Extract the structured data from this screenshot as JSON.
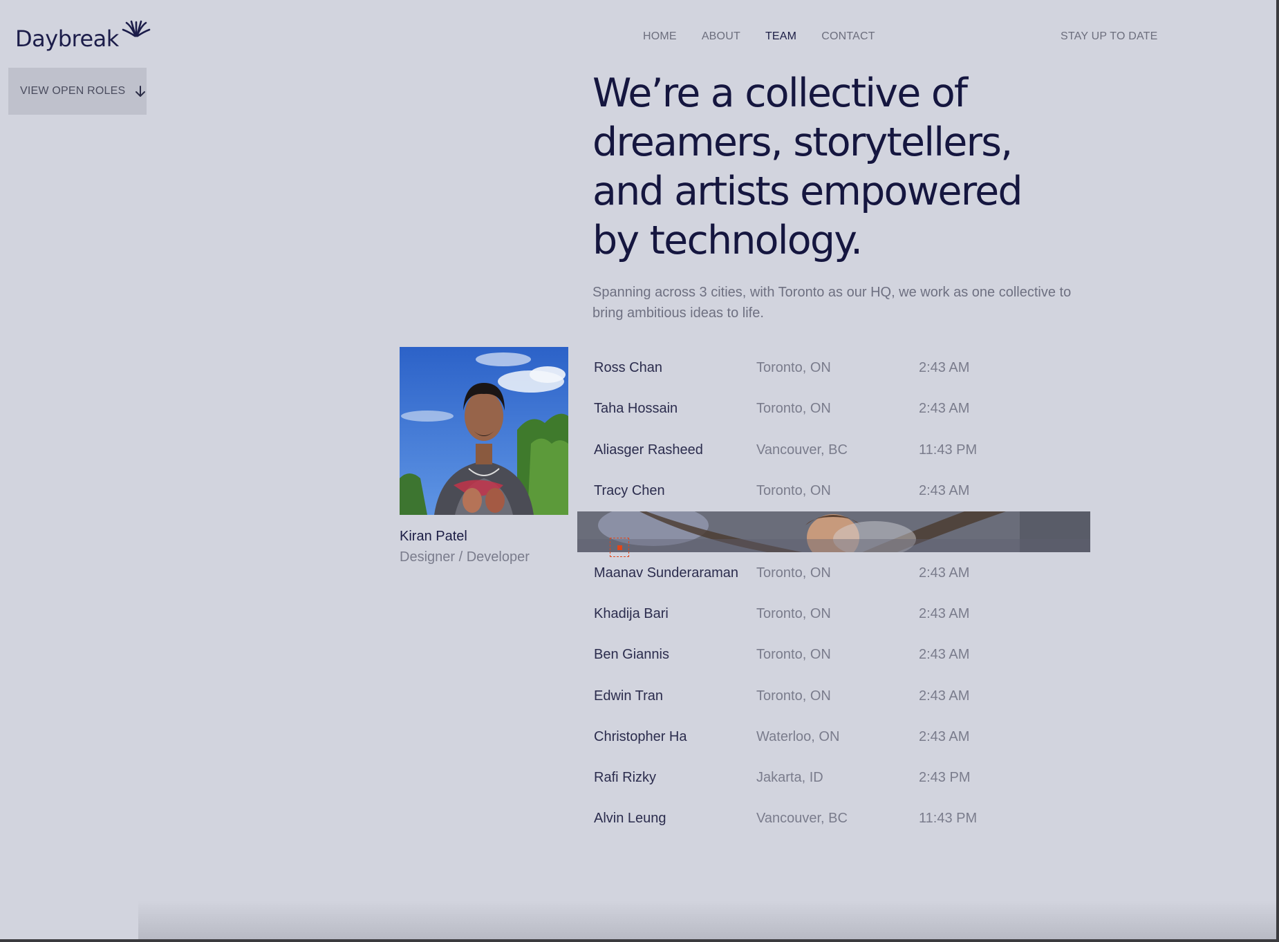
{
  "brand": {
    "name": "Daybreak"
  },
  "nav": {
    "items": [
      {
        "label": "HOME",
        "active": false
      },
      {
        "label": "ABOUT",
        "active": false
      },
      {
        "label": "TEAM",
        "active": true
      },
      {
        "label": "CONTACT",
        "active": false
      }
    ],
    "cta": "STAY UP TO DATE"
  },
  "roles_button": {
    "label": "VIEW OPEN ROLES",
    "icon": "arrow-down-icon"
  },
  "hero": {
    "headline_lines": [
      "We’re a collective of",
      "dreamers, storytellers,",
      "and artists empowered",
      "by technology."
    ],
    "subtitle": "Spanning across 3 cities, with Toronto as our HQ, we work as one collective to bring ambitious ideas to life."
  },
  "feature": {
    "name": "Kiran Patel",
    "role": "Designer / Developer"
  },
  "team": [
    {
      "name": "Ross Chan",
      "city": "Toronto, ON",
      "time": "2:43 AM"
    },
    {
      "name": "Taha Hossain",
      "city": "Toronto, ON",
      "time": "2:43 AM"
    },
    {
      "name": "Aliasger Rasheed",
      "city": "Vancouver, BC",
      "time": "11:43 PM"
    },
    {
      "name": "Tracy Chen",
      "city": "Toronto, ON",
      "time": "2:43 AM"
    },
    {
      "name": "",
      "city": "",
      "time": "",
      "hovered": true
    },
    {
      "name": "Maanav Sunderaraman",
      "city": "Toronto, ON",
      "time": "2:43 AM"
    },
    {
      "name": "Khadija Bari",
      "city": "Toronto, ON",
      "time": "2:43 AM"
    },
    {
      "name": "Ben Giannis",
      "city": "Toronto, ON",
      "time": "2:43 AM"
    },
    {
      "name": "Edwin Tran",
      "city": "Toronto, ON",
      "time": "2:43 AM"
    },
    {
      "name": "Christopher Ha",
      "city": "Waterloo, ON",
      "time": "2:43 AM"
    },
    {
      "name": "Rafi Rizky",
      "city": "Jakarta, ID",
      "time": "2:43 PM"
    },
    {
      "name": "Alvin Leung",
      "city": "Vancouver, BC",
      "time": "11:43 PM"
    }
  ],
  "colors": {
    "background": "#d2d4de",
    "ink": "#15163f",
    "muted": "#7a7c8c",
    "cursor_accent": "#e0461a"
  }
}
